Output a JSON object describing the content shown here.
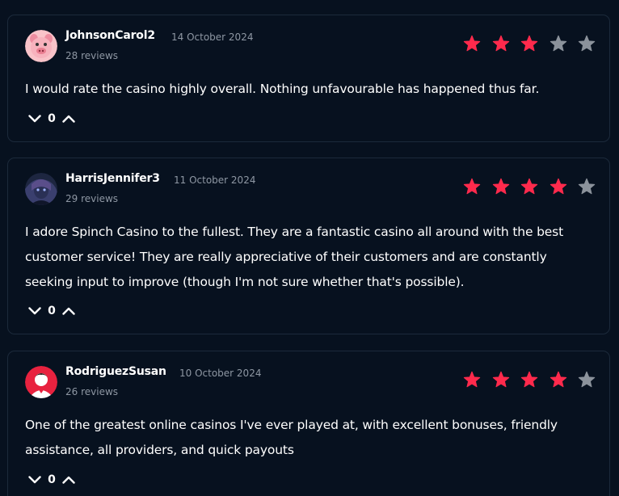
{
  "colors": {
    "background": "#07111f",
    "card_border": "#1c2a3b",
    "star_filled": "#ff2a4c",
    "star_empty": "#8b929b",
    "muted_text": "#8e97a3"
  },
  "reviews": [
    {
      "username": "JohnsonCarol2",
      "date": "14 October 2024",
      "review_count": "28 reviews",
      "rating": 3,
      "max_rating": 5,
      "text": "I would rate the casino highly overall. Nothing unfavourable has happened thus far.",
      "votes": "0",
      "avatar": "pink-pig-avatar"
    },
    {
      "username": "HarrisJennifer3",
      "date": "11 October 2024",
      "review_count": "29 reviews",
      "rating": 4,
      "max_rating": 5,
      "text": "I adore Spinch Casino to the fullest. They are a fantastic casino all around with the best customer service! They are really appreciative of their customers and are constantly seeking input to improve (though I'm not sure whether that's possible).",
      "votes": "0",
      "avatar": "photo-avatar"
    },
    {
      "username": "RodriguezSusan",
      "date": "10 October 2024",
      "review_count": "26 reviews",
      "rating": 4,
      "max_rating": 5,
      "text": "One of the greatest online casinos I've ever played at, with excellent bonuses, friendly assistance, all providers, and quick payouts",
      "votes": "0",
      "avatar": "red-person-avatar"
    }
  ],
  "icons": {
    "downvote": "chevron-down-icon",
    "upvote": "chevron-up-icon",
    "star": "star-icon"
  }
}
